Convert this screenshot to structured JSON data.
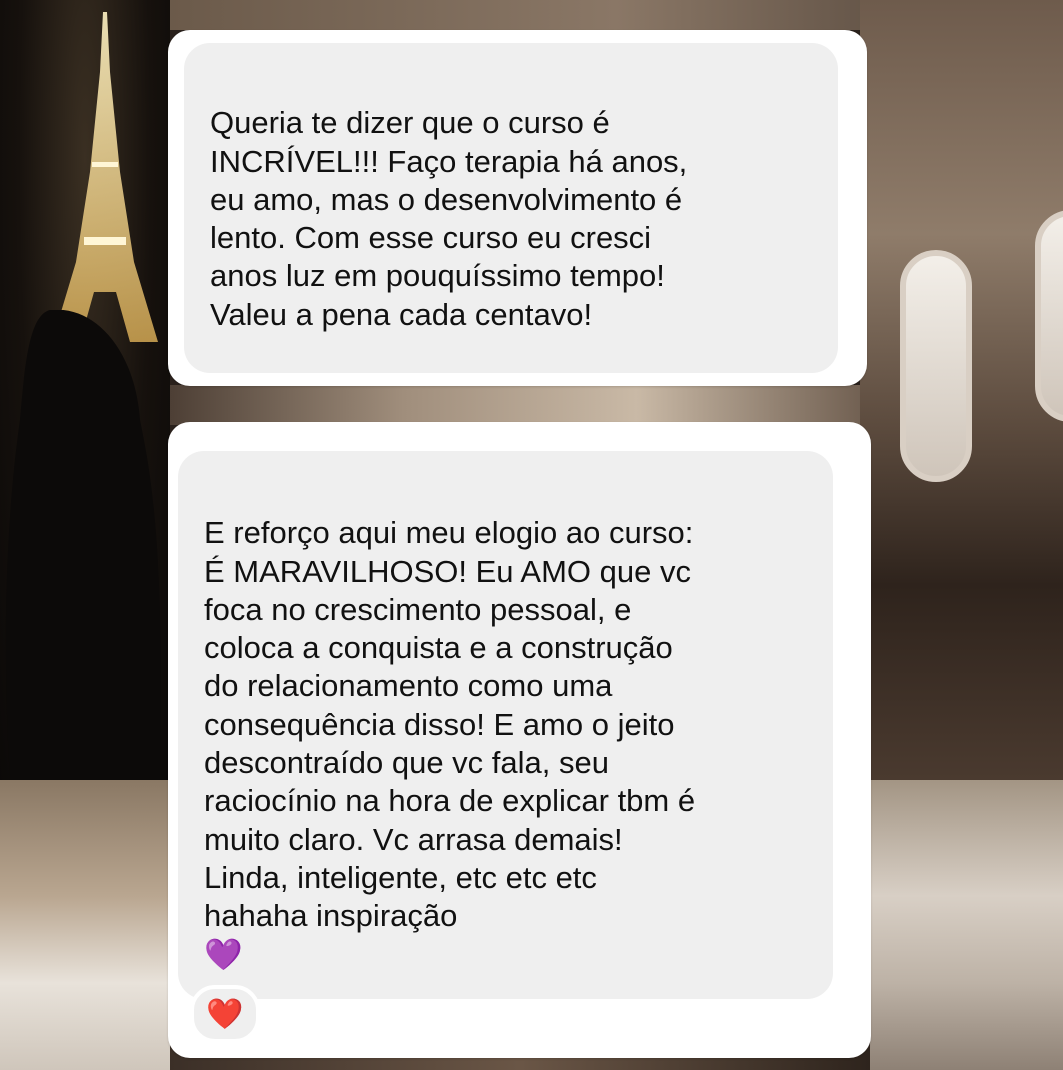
{
  "messages": [
    {
      "text": "Queria te dizer que o curso é\nINCRÍVEL!!! Faço terapia há anos,\neu amo, mas o desenvolvimento é\nlento. Com esse curso eu cresci\nanos luz em pouquíssimo tempo!\nValeu a pena cada centavo!"
    },
    {
      "text": "E reforço aqui meu elogio ao curso:\nÉ MARAVILHOSO! Eu AMO que vc\nfoca no crescimento pessoal, e\ncoloca a conquista e a construção\ndo relacionamento como uma\nconsequência disso! E amo o jeito\ndescontraído que vc fala, seu\nraciocínio na hora de explicar tbm é\nmuito claro. Vc arrasa demais!\nLinda, inteligente, etc etc etc\nhahaha inspiração",
      "emoji": "💜",
      "reaction": "❤️"
    }
  ],
  "colors": {
    "bubble_bg": "#efefef",
    "card_bg": "#ffffff",
    "text": "#111111"
  }
}
